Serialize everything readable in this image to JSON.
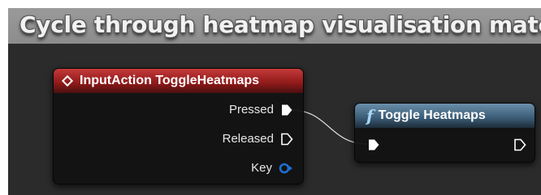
{
  "title": "Cycle through heatmap visualisation materials",
  "colors": {
    "graph_background": "#2b2b2b",
    "event_header": "#8e1919",
    "function_header": "#3a5b74",
    "key_pin": "#1e6fd1"
  },
  "input_action_node": {
    "title": "InputAction ToggleHeatmaps",
    "icon": "input-action-diamond-icon",
    "pins": {
      "pressed": "Pressed",
      "released": "Released",
      "key": "Key"
    }
  },
  "function_node": {
    "icon_glyph": "f",
    "title": "Toggle Heatmaps"
  }
}
